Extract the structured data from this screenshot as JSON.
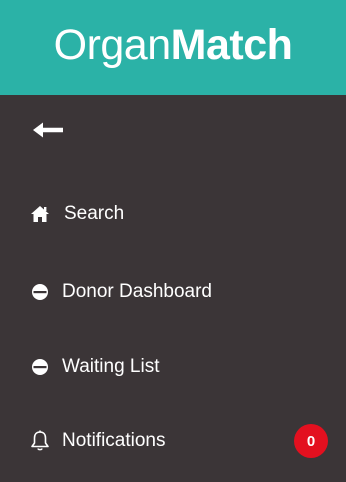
{
  "theme": {
    "brand_color": "#2bb2a7",
    "sidebar_bg": "#3b3537",
    "badge_color": "#e3101f"
  },
  "brand": {
    "light": "Organ",
    "bold": "Match"
  },
  "nav": {
    "back_icon": "arrow-left-icon",
    "items": [
      {
        "label": "Search",
        "icon": "home-icon"
      },
      {
        "label": "Donor Dashboard",
        "icon": "half-circle-icon"
      },
      {
        "label": "Waiting List",
        "icon": "half-circle-icon"
      },
      {
        "label": "Notifications",
        "icon": "bell-icon",
        "badge": "0"
      }
    ]
  }
}
